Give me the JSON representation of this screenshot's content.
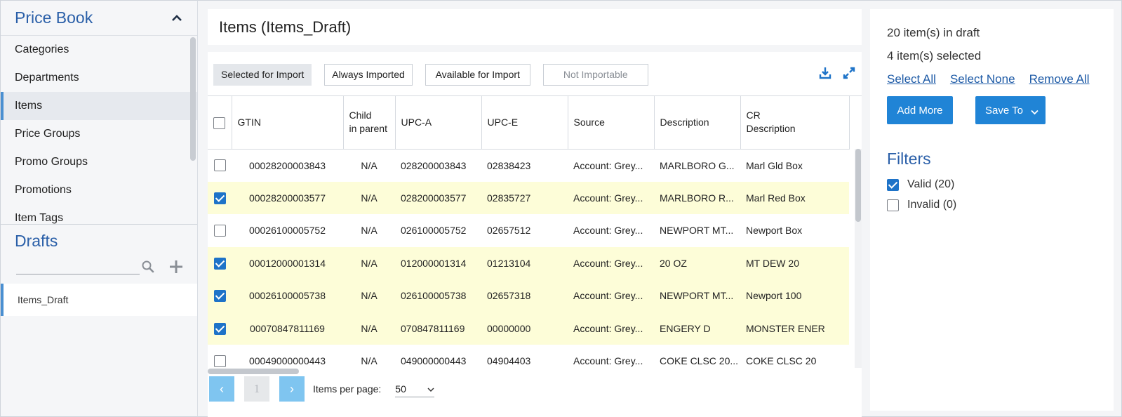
{
  "sidebar": {
    "title": "Price Book",
    "items": [
      {
        "label": "Categories"
      },
      {
        "label": "Departments"
      },
      {
        "label": "Items"
      },
      {
        "label": "Price Groups"
      },
      {
        "label": "Promo Groups"
      },
      {
        "label": "Promotions"
      },
      {
        "label": "Item Tags"
      }
    ],
    "active_item": "Items",
    "drafts_title": "Drafts",
    "drafts_search_placeholder": "",
    "drafts": [
      {
        "label": "Items_Draft"
      }
    ]
  },
  "main": {
    "title": "Items (Items_Draft)",
    "tabs": [
      {
        "label": "Selected for Import",
        "state": "selected"
      },
      {
        "label": "Always Imported",
        "state": "normal"
      },
      {
        "label": "Available for Import",
        "state": "normal"
      },
      {
        "label": "Not Importable",
        "state": "disabled"
      }
    ],
    "tool_icons": [
      "download-icon",
      "expand-icon"
    ],
    "columns": [
      "GTIN",
      "Child in parent",
      "UPC-A",
      "UPC-E",
      "Source",
      "Description",
      "CR Description"
    ],
    "column_lines": {
      "child": [
        "Child",
        "in parent"
      ],
      "cr": [
        "CR",
        "Description"
      ]
    },
    "rows": [
      {
        "checked": false,
        "gtin": "00028200003843",
        "child": "N/A",
        "upca": "028200003843",
        "upce": "02838423",
        "source": "Account: Grey...",
        "description": "MARLBORO G...",
        "cr_description": "Marl Gld Box"
      },
      {
        "checked": true,
        "gtin": "00028200003577",
        "child": "N/A",
        "upca": "028200003577",
        "upce": "02835727",
        "source": "Account: Grey...",
        "description": "MARLBORO R...",
        "cr_description": "Marl Red Box"
      },
      {
        "checked": false,
        "gtin": "00026100005752",
        "child": "N/A",
        "upca": "026100005752",
        "upce": "02657512",
        "source": "Account: Grey...",
        "description": "NEWPORT MT...",
        "cr_description": "Newport Box"
      },
      {
        "checked": true,
        "gtin": "00012000001314",
        "child": "N/A",
        "upca": "012000001314",
        "upce": "01213104",
        "source": "Account: Grey...",
        "description": "20 OZ",
        "cr_description": "MT DEW 20"
      },
      {
        "checked": true,
        "gtin": "00026100005738",
        "child": "N/A",
        "upca": "026100005738",
        "upce": "02657318",
        "source": "Account: Grey...",
        "description": "NEWPORT MT...",
        "cr_description": "Newport 100"
      },
      {
        "checked": true,
        "gtin": "00070847811169",
        "child": "N/A",
        "upca": "070847811169",
        "upce": "00000000",
        "source": "Account: Grey...",
        "description": "ENGERY D",
        "cr_description": "MONSTER ENER"
      },
      {
        "checked": false,
        "gtin": "00049000000443",
        "child": "N/A",
        "upca": "049000000443",
        "upce": "04904403",
        "source": "Account: Grey...",
        "description": "COKE CLSC 20...",
        "cr_description": "COKE CLSC 20"
      }
    ],
    "pager": {
      "prev": "‹",
      "page": "1",
      "next": "›",
      "per_page_label": "Items per page:",
      "per_page_value": "50"
    }
  },
  "right": {
    "in_draft": "20 item(s) in draft",
    "selected": "4 item(s) selected",
    "select_all": "Select All",
    "select_none": "Select None",
    "remove_all": "Remove All",
    "add_more": "Add More",
    "save_to": "Save To",
    "filters_title": "Filters",
    "filters": [
      {
        "label": "Valid (20)",
        "checked": true
      },
      {
        "label": "Invalid (0)",
        "checked": false
      }
    ]
  },
  "colors": {
    "accent_blue": "#2a5fa8",
    "button_blue": "#2084d6",
    "highlight_row": "#fdfdd8",
    "pager_blue": "#7fc5f0"
  }
}
